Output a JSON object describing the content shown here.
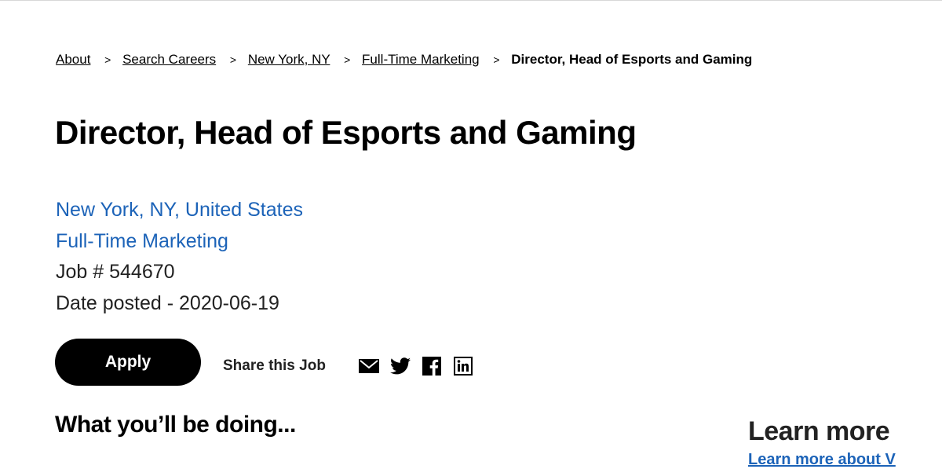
{
  "breadcrumb": {
    "items": [
      "About",
      "Search Careers",
      "New York, NY",
      "Full-Time Marketing"
    ],
    "separator": ">",
    "current": "Director, Head of Esports and Gaming"
  },
  "job": {
    "title": "Director, Head of Esports and Gaming",
    "location": "New York, NY, United States",
    "category": "Full-Time Marketing",
    "job_number": "Job # 544670",
    "date_posted": "Date posted - 2020-06-19"
  },
  "actions": {
    "apply_label": "Apply",
    "share_label": "Share this Job",
    "share_icons": [
      "email-icon",
      "twitter-icon",
      "facebook-icon",
      "linkedin-icon"
    ]
  },
  "sections": {
    "doing_heading": "What you’ll be doing...",
    "learn_more_heading": "Learn more",
    "learn_more_link": "Learn more about V"
  },
  "colors": {
    "link": "#1c63b8",
    "button_bg": "#000000",
    "button_text": "#ffffff"
  }
}
